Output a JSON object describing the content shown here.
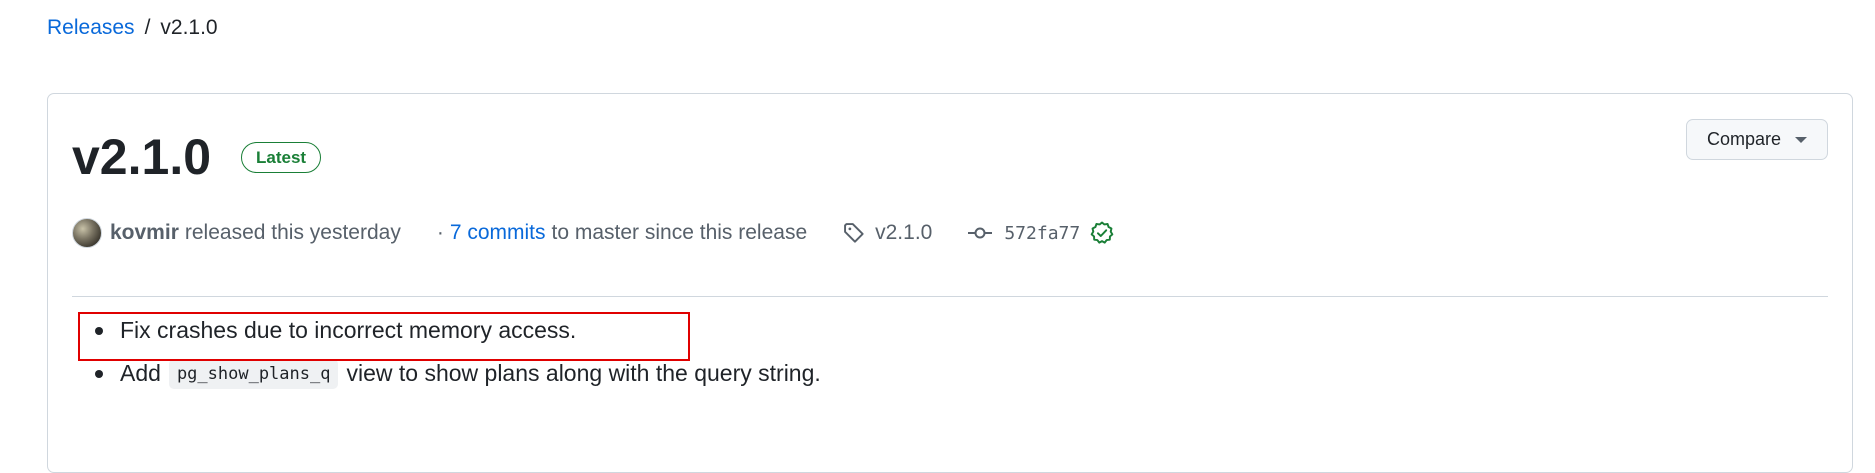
{
  "breadcrumb": {
    "releases_label": "Releases",
    "separator": "/",
    "current": "v2.1.0"
  },
  "release": {
    "title": "v2.1.0",
    "badge": "Latest",
    "compare_label": "Compare",
    "author": "kovmir",
    "released_text": "released this yesterday",
    "dot": "·",
    "commits_link": "7 commits",
    "commits_rest": "to master since this release",
    "tag": "v2.1.0",
    "commit_sha": "572fa77",
    "notes": [
      {
        "text": "Fix crashes due to incorrect memory access."
      },
      {
        "prefix": "Add",
        "code": "pg_show_plans_q",
        "suffix": "view to show plans along with the query string."
      }
    ]
  },
  "colors": {
    "link": "#0969da",
    "latest_badge": "#1a7f37",
    "verified": "#1a7f37",
    "highlight": "#e00000"
  },
  "icons": {
    "tag": "tag-icon",
    "commit": "git-commit-icon",
    "verified": "verified-check-icon",
    "caret": "caret-down-icon"
  }
}
